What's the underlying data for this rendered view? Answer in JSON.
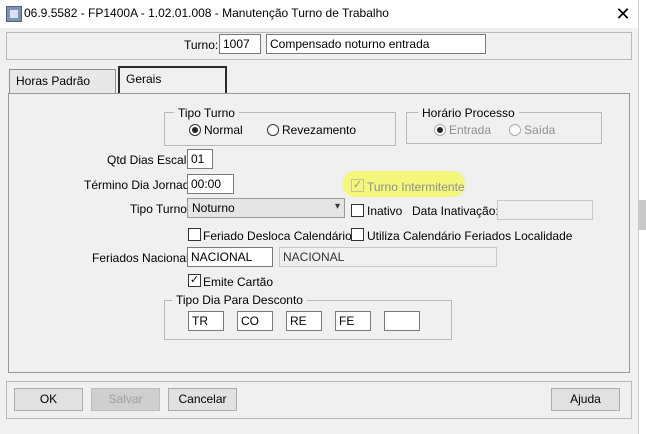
{
  "window": {
    "title": "06.9.5582 - FP1400A - 1.02.01.008 - Manutenção Turno de Trabalho",
    "close_glyph": "✕"
  },
  "header": {
    "turno_label": "Turno:",
    "turno_code": "1007",
    "turno_desc": "Compensado noturno entrada"
  },
  "tabs": [
    {
      "label": "Horas Padrão"
    },
    {
      "label": "Gerais"
    }
  ],
  "tipo_turno_group": {
    "title": "Tipo Turno",
    "normal": "Normal",
    "revezamento": "Revezamento"
  },
  "horario_processo": {
    "title": "Horário Processo",
    "entrada": "Entrada",
    "saida": "Saída"
  },
  "fields": {
    "qtd_dias_label": "Qtd Dias Escala:",
    "qtd_dias_value": "01",
    "termino_label": "Término Dia Jornada:",
    "termino_value": "00:00",
    "turno_intermitente": "Turno Intermitente",
    "tipo_turno_label": "Tipo Turno:",
    "tipo_turno_value": "Noturno",
    "inativo": "Inativo",
    "data_inativacao_label": "Data Inativação:",
    "data_inativacao_value": "",
    "feriado_desloca": "Feriado Desloca Calendário",
    "utiliza_calendario": "Utiliza Calendário Feriados Localidade",
    "feriados_label": "Feriados Nacionais:",
    "feriados_code": "NACIONAL",
    "feriados_desc": "NACIONAL",
    "emite_cartao": "Emite Cartão"
  },
  "tipo_dia_desconto": {
    "title": "Tipo Dia Para Desconto",
    "values": [
      "TR",
      "CO",
      "RE",
      "FE",
      ""
    ]
  },
  "buttons": {
    "ok": "OK",
    "salvar": "Salvar",
    "cancelar": "Cancelar",
    "ajuda": "Ajuda"
  },
  "colors": {
    "highlight": "#f4f77a"
  },
  "icons": {
    "dropdown": "▾",
    "check": "✓"
  }
}
